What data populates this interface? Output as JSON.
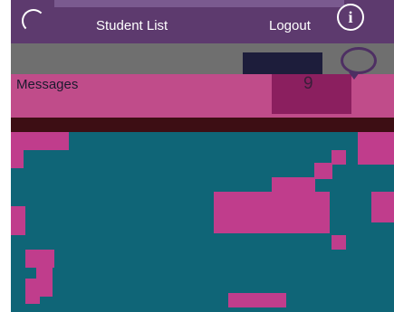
{
  "header": {
    "student_list_label": "Student List",
    "logout_label": "Logout",
    "info_glyph": "i",
    "background_color": "#5d3a6e"
  },
  "messages": {
    "label": "Messages",
    "count": "9",
    "icon": "chat-bubble-icon"
  },
  "colors": {
    "accent": "#c04c8a",
    "content_bg": "#0f6577"
  }
}
